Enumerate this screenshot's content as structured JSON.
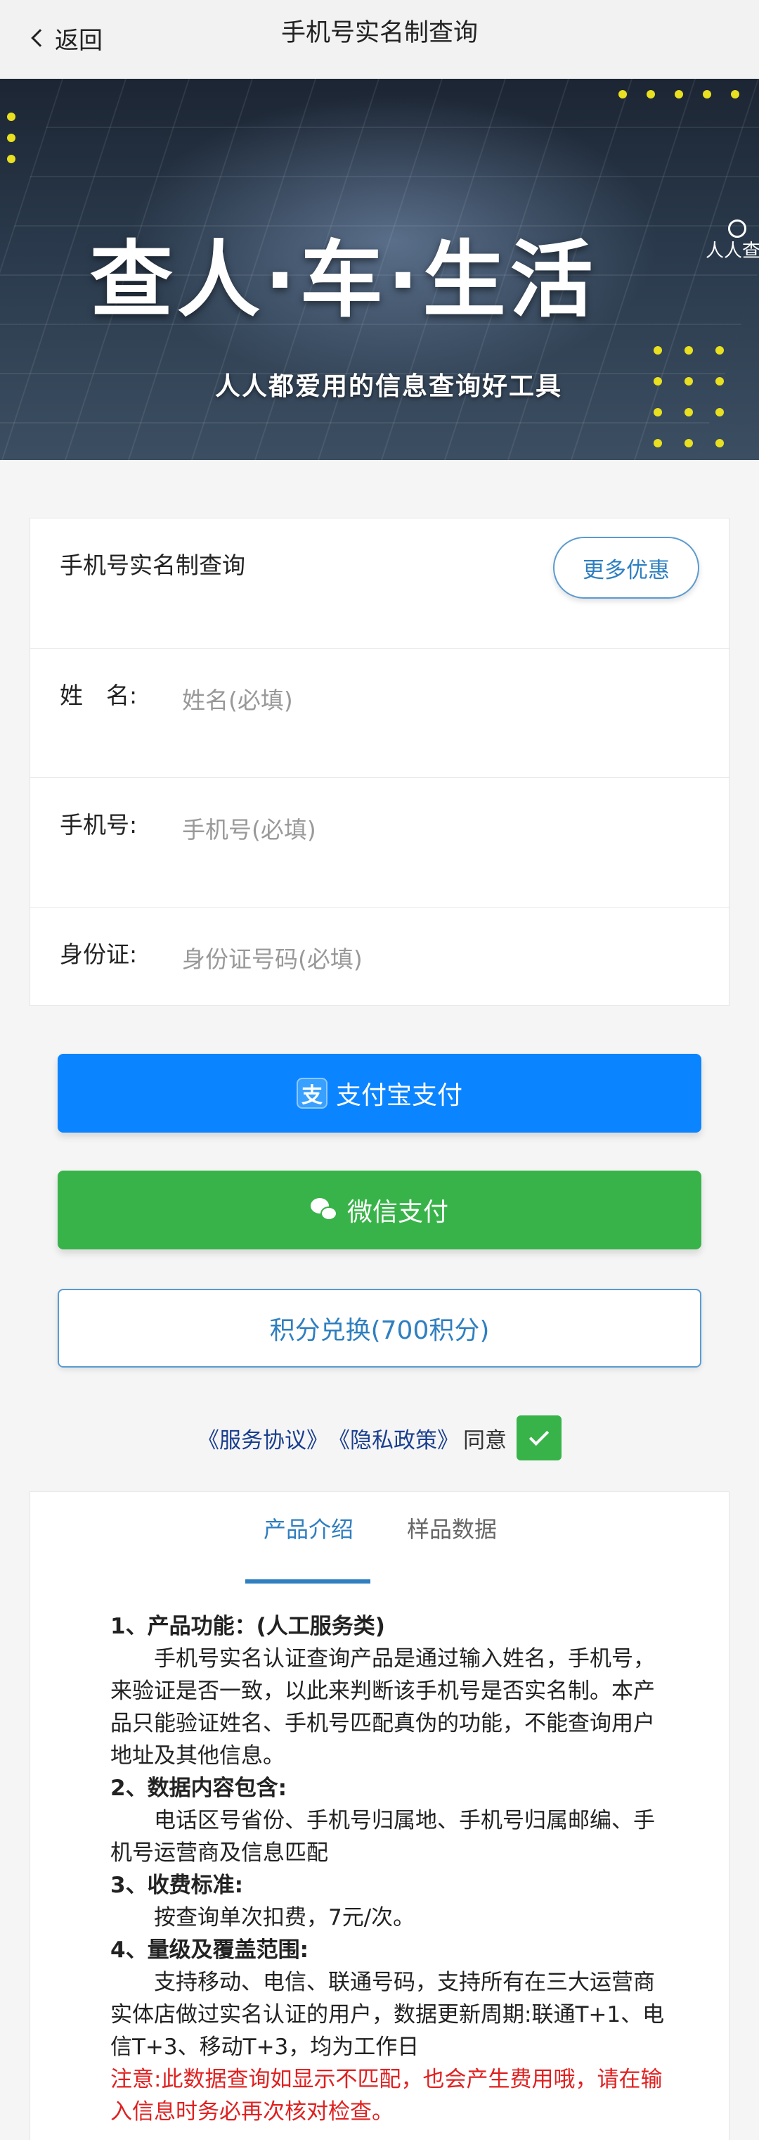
{
  "header": {
    "back_label": "返回",
    "title": "手机号实名制查询"
  },
  "banner": {
    "headline": "查人·车·生活",
    "subline": "人人都爱用的信息查询好工具",
    "logo_text": "人人查",
    "pager_count": 3,
    "pager_active": 1
  },
  "form": {
    "title": "手机号实名制查询",
    "promo_label": "更多优惠",
    "fields": [
      {
        "label": "姓　名:",
        "placeholder": "姓名(必填)",
        "value": ""
      },
      {
        "label": "手机号:",
        "placeholder": "手机号(必填)",
        "value": ""
      },
      {
        "label": "身份证:",
        "placeholder": "身份证号码(必填)",
        "value": ""
      }
    ]
  },
  "pay": {
    "alipay_label": "支付宝支付",
    "alipay_icon_char": "支",
    "wechat_label": "微信支付",
    "points_label": "积分兑换(700积分)"
  },
  "agreement": {
    "service": "《服务协议》",
    "privacy": "《隐私政策》",
    "agree_text": "同意",
    "checked": true
  },
  "info": {
    "tabs": [
      "产品介绍",
      "样品数据"
    ],
    "active_tab": 0,
    "s1_title": "1、产品功能：(人工服务类)",
    "s1_body": "手机号实名认证查询产品是通过输入姓名，手机号，来验证是否一致，以此来判断该手机号是否实名制。本产品只能验证姓名、手机号匹配真伪的功能，不能查询用户地址及其他信息。",
    "s2_title": "2、数据内容包含:",
    "s2_body": "电话区号省份、手机号归属地、手机号归属邮编、手机号运营商及信息匹配",
    "s3_title": "3、收费标准:",
    "s3_body": "按查询单次扣费，7元/次。",
    "s4_title": "4、量级及覆盖范围:",
    "s4_body": "支持移动、电信、联通号码，支持所有在三大运营商实体店做过实名认证的用户，数据更新周期:联通T+1、电信T+3、移动T+3，均为工作日",
    "notice": "注意:此数据查询如显示不匹配，也会产生费用哦，请在输入信息时务必再次核对检查。"
  },
  "colors": {
    "primary": "#0b84ff",
    "wechat": "#38b349",
    "accent": "#2f7fc0",
    "warning": "#e02020"
  }
}
